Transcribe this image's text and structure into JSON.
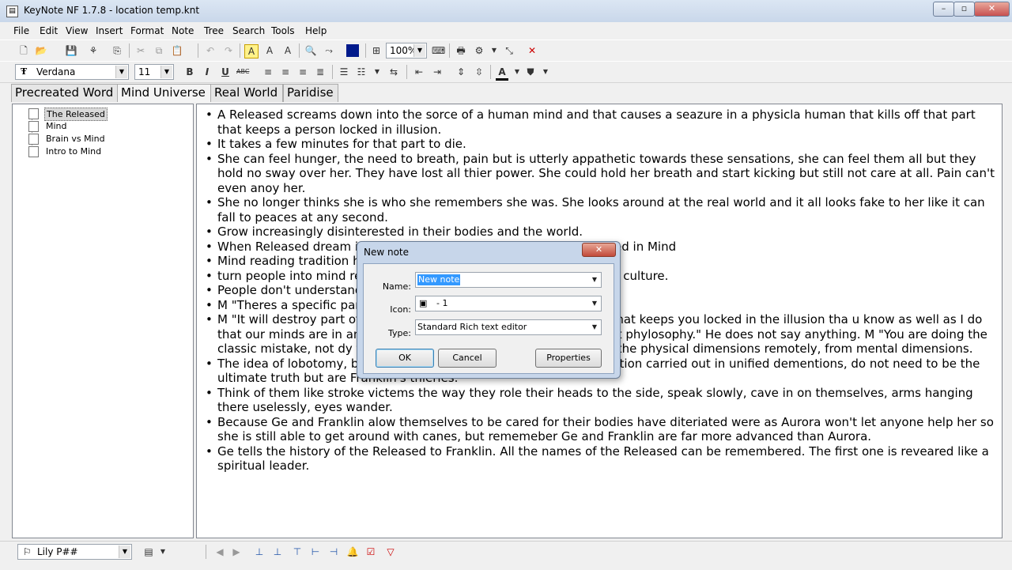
{
  "window": {
    "title": "KeyNote NF  1.7.8 - location temp.knt",
    "controls": {
      "minimize": "–",
      "maximize": "▫",
      "close": "✕"
    }
  },
  "menu": [
    "File",
    "Edit",
    "View",
    "Insert",
    "Format",
    "Note",
    "Tree",
    "Search",
    "Tools",
    "Help"
  ],
  "toolbar": {
    "zoom": "100%",
    "font_name": "Verdana",
    "font_size": "11"
  },
  "tabs": [
    "Precreated Word",
    "Mind Universe",
    "Real World",
    "Paridise"
  ],
  "active_tab": 1,
  "tree": {
    "items": [
      "The Released",
      "Mind",
      "Brain vs Mind",
      "Intro to Mind"
    ],
    "selected": 0
  },
  "editor": {
    "bullets": [
      "A Released screams down into the sorce of a human mind and that causes a seazure in a physicla human that kills off that part that keeps a person locked in illusion.",
      "It takes a few minutes for that part to die.",
      "She can feel hunger, the need to breath, pain but is utterly appathetic towards these sensations, she can feel them all but they hold no sway over her. They have lost all thier power. She could hold her breath and start kicking but still not care at all. Pain can't even anoy her.",
      "She no longer thinks she is who she remembers she was. She looks around at the real world and it all looks fake to her like it can fall to peaces at any second.",
      "Grow increasingly disinterested in their bodies and the world.",
      "When Released dream i                                                                    ses conscious control and becomes desolved in Mind",
      "Mind reading tradition ha",
      "turn people into mind re                                                                          stic. Part of the whole brutality of freak act culture.",
      "People don't understand",
      "M \"Theres a specific par",
      "M \"It will destroy part of                                                                         do that\" M \"But it's the part of your brain that keeps you locked in the illusion tha                                                                     u know as well as I do that our minds are in another universe and we are operating ou                                                                 just phylosophy.\" He does not say anything. M \"You are doing the classic mistake, not                                                                   dy there, in Mind, gathering information about the physical dimensions remotely, from mental dimensions.",
      "The idea of lobotomy, brain as transmitter/receaver, brain computation carried out in unified dementions, do not need to be the ultimate truth but are Franklin's thieries.",
      "Think of them like stroke victems the way they role their heads to the side, speak slowly, cave in on themselves, arms hanging there uselessly, eyes wander.",
      "Because Ge and Franklin alow themselves to be cared for their bodies have diteriated were as Aurora won't let anyone help her so she is still able to get around with canes, but rememeber Ge and Franklin are far more advanced than Aurora.",
      "Ge tells the history of the Released to Franklin. All the names of the Released can be remembered. The first one is reveared like a spiritual leader."
    ]
  },
  "statusbar": {
    "style_combo": "Lily P##"
  },
  "dialog": {
    "title": "New note",
    "close": "✕",
    "name_label": "Name:",
    "name_value": "New note",
    "icon_label": "Icon:",
    "icon_value": "- 1",
    "type_label": "Type:",
    "type_value": "Standard Rich text editor",
    "ok": "OK",
    "cancel": "Cancel",
    "properties": "Properties"
  }
}
